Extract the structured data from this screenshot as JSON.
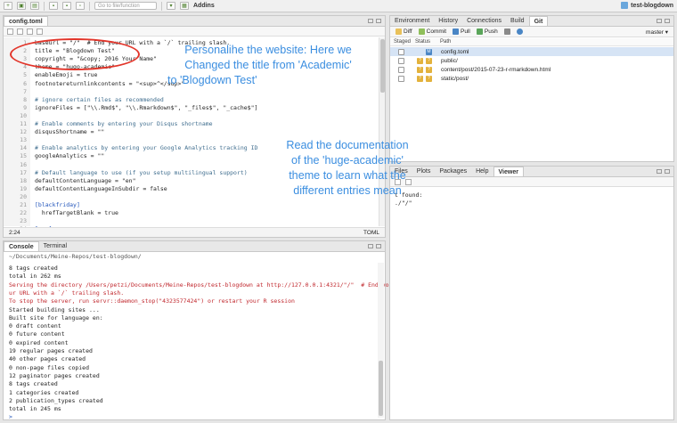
{
  "toolbar": {
    "goto_placeholder": "Go to file/function",
    "addins_label": "Addins",
    "project_name": "test-blogdown"
  },
  "editor": {
    "tab_label": "config.toml",
    "status_position": "2:24",
    "status_filetype": "TOML",
    "lines": [
      {
        "n": "1",
        "text": "baseurl = \"/\"  # End your URL with a `/` trailing slash."
      },
      {
        "n": "2",
        "text": "title = \"Blogdown Test\""
      },
      {
        "n": "3",
        "text": "copyright = \"&copy; 2016 Your Name\""
      },
      {
        "n": "4",
        "text": "theme = \"hugo-academic\""
      },
      {
        "n": "5",
        "text": "enableEmoji = true"
      },
      {
        "n": "6",
        "text": "footnotereturnlinkcontents = \"<sup>^</sup>\""
      },
      {
        "n": "7",
        "text": ""
      },
      {
        "n": "8",
        "text": "# ignore certain files as recommended"
      },
      {
        "n": "9",
        "text": "ignoreFiles = [\"\\\\.Rmd$\", \"\\\\.Rmarkdown$\", \"_files$\", \"_cache$\"]"
      },
      {
        "n": "10",
        "text": ""
      },
      {
        "n": "11",
        "text": "# Enable comments by entering your Disqus shortname"
      },
      {
        "n": "12",
        "text": "disqusShortname = \"\""
      },
      {
        "n": "13",
        "text": ""
      },
      {
        "n": "14",
        "text": "# Enable analytics by entering your Google Analytics tracking ID"
      },
      {
        "n": "15",
        "text": "googleAnalytics = \"\""
      },
      {
        "n": "16",
        "text": ""
      },
      {
        "n": "17",
        "text": "# Default language to use (if you setup multilingual support)"
      },
      {
        "n": "18",
        "text": "defaultContentLanguage = \"en\""
      },
      {
        "n": "19",
        "text": "defaultContentLanguageInSubdir = false"
      },
      {
        "n": "20",
        "text": ""
      },
      {
        "n": "21",
        "text": "[blackfriday]"
      },
      {
        "n": "22",
        "text": "  hrefTargetBlank = true"
      },
      {
        "n": "23",
        "text": ""
      },
      {
        "n": "24",
        "text": "[...]"
      }
    ]
  },
  "console": {
    "tabs": [
      "Console",
      "Terminal"
    ],
    "path": "~/Documents/Meine-Repos/test-blogdown/",
    "lines": [
      {
        "kind": "out",
        "text": "8 tags created"
      },
      {
        "kind": "out",
        "text": "total in 262 ms"
      },
      {
        "kind": "err",
        "text": "Serving the directory /Users/petzi/Documents/Meine-Repos/test-blogdown at http://127.0.0.1:4321/\"/\"  # End yo"
      },
      {
        "kind": "err",
        "text": "ur URL with a `/` trailing slash."
      },
      {
        "kind": "err",
        "text": "To stop the server, run servr::daemon_stop(\"4323577424\") or restart your R session"
      },
      {
        "kind": "out",
        "text": "Started building sites ..."
      },
      {
        "kind": "out",
        "text": "Built site for language en:"
      },
      {
        "kind": "out",
        "text": "0 draft content"
      },
      {
        "kind": "out",
        "text": "0 future content"
      },
      {
        "kind": "out",
        "text": "0 expired content"
      },
      {
        "kind": "out",
        "text": "19 regular pages created"
      },
      {
        "kind": "out",
        "text": "40 other pages created"
      },
      {
        "kind": "out",
        "text": "0 non-page files copied"
      },
      {
        "kind": "out",
        "text": "12 paginator pages created"
      },
      {
        "kind": "out",
        "text": "8 tags created"
      },
      {
        "kind": "out",
        "text": "1 categories created"
      },
      {
        "kind": "out",
        "text": "2 publication_types created"
      },
      {
        "kind": "out",
        "text": "total in 245 ms"
      },
      {
        "kind": "prompt",
        "text": ">"
      }
    ]
  },
  "git": {
    "tabs": [
      "Environment",
      "History",
      "Connections",
      "Build",
      "Git"
    ],
    "diff_label": "Diff",
    "commit_label": "Commit",
    "pull_label": "Pull",
    "push_label": "Push",
    "branch": "master",
    "col_staged": "Staged",
    "col_status": "Status",
    "col_path": "Path",
    "rows": [
      {
        "path": "config.toml",
        "status": "M"
      },
      {
        "path": "public/",
        "status": "?"
      },
      {
        "path": "content/post/2015-07-23-r-rmarkdown.html",
        "status": "?"
      },
      {
        "path": "static/post/",
        "status": "?"
      }
    ]
  },
  "files": {
    "tabs": [
      "Files",
      "Plots",
      "Packages",
      "Help",
      "Viewer"
    ],
    "lines": [
      "t found:",
      "./\"/\""
    ]
  },
  "annotations": {
    "note1": [
      "Personalihe the website: Here we",
      "Changed the title from 'Academic'",
      "to 'Blogdown Test'"
    ],
    "note2": [
      "Read the documentation",
      "of the 'huge-academic'",
      "theme to learn what the",
      "different entries mean"
    ]
  },
  "colors": {
    "annotation": "#3b8ee0",
    "highlight_oval": "#e2352a",
    "error_text": "#c0272d"
  }
}
